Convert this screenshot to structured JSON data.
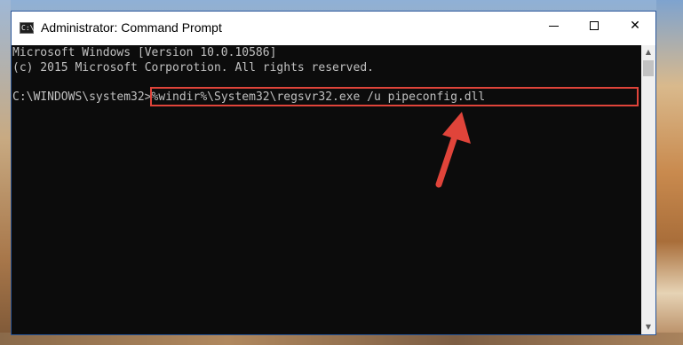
{
  "window": {
    "title": "Administrator: Command Prompt",
    "icon": "command-prompt-icon",
    "icon_glyph": "C:\\"
  },
  "controls": {
    "minimize_icon": "minimize-icon",
    "maximize_icon": "maximize-icon",
    "close_icon": "close-icon",
    "close_glyph": "✕"
  },
  "console": {
    "line1": "Microsoft Windows [Version 10.0.10586]",
    "line2": "(c) 2015 Microsoft Corporotion. All rights reserved.",
    "prompt": "C:\\WINDOWS\\system32>",
    "command": "%windir%\\System32\\regsvr32.exe /u pipeconfig.dll"
  },
  "scrollbar": {
    "up_glyph": "▲",
    "down_glyph": "▼"
  },
  "colors": {
    "console_bg": "#0c0c0c",
    "console_text": "#c0c0c0",
    "highlight": "#e0443a"
  }
}
